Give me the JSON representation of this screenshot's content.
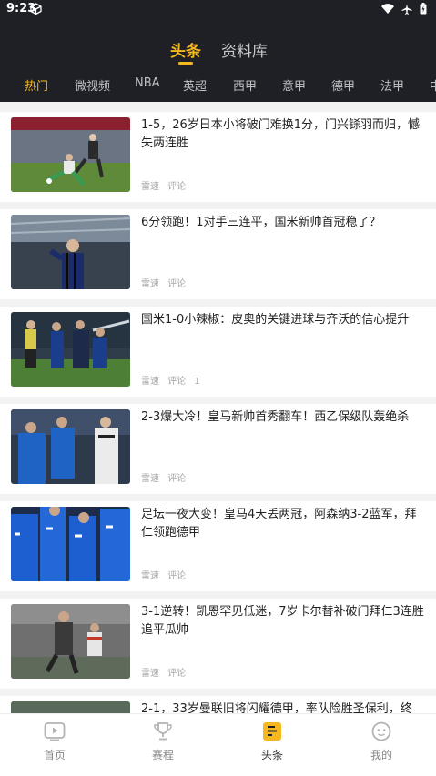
{
  "status": {
    "time": "9:23"
  },
  "top_tabs": [
    {
      "label": "头条",
      "active": true
    },
    {
      "label": "资料库",
      "active": false
    }
  ],
  "categories": [
    "热门",
    "微视频",
    "NBA",
    "英超",
    "西甲",
    "意甲",
    "德甲",
    "法甲",
    "中"
  ],
  "articles": [
    {
      "title": "1-5，26岁日本小将破门难换1分，门兴铩羽而归，憾失两连胜",
      "source": "雷速",
      "comment_label": "评论",
      "comment_count": ""
    },
    {
      "title": "6分领跑！1对手三连平，国米新帅首冠稳了？",
      "source": "雷速",
      "comment_label": "评论",
      "comment_count": ""
    },
    {
      "title": "国米1-0小辣椒：皮奥的关键进球与齐沃的信心提升",
      "source": "雷速",
      "comment_label": "评论",
      "comment_count": "1"
    },
    {
      "title": "2-3爆大冷！皇马新帅首秀翻车！西乙保级队轰绝杀",
      "source": "雷速",
      "comment_label": "评论",
      "comment_count": ""
    },
    {
      "title": "足坛一夜大变！皇马4天丢两冠，阿森纳3-2蓝军，拜仁领跑德甲",
      "source": "雷速",
      "comment_label": "评论",
      "comment_count": ""
    },
    {
      "title": "3-1逆转！凯恩罕见低迷，7岁卡尔替补破门拜仁3连胜追平瓜帅",
      "source": "雷速",
      "comment_label": "评论",
      "comment_count": ""
    },
    {
      "title": "2-1，33岁曼联旧将闪耀德甲，率队险胜圣保利，终",
      "source": "",
      "comment_label": "",
      "comment_count": ""
    }
  ],
  "bottom_nav": [
    {
      "label": "首页",
      "icon": "play-icon",
      "active": false
    },
    {
      "label": "赛程",
      "icon": "trophy-icon",
      "active": false
    },
    {
      "label": "头条",
      "icon": "news-icon",
      "active": true
    },
    {
      "label": "我的",
      "icon": "profile-icon",
      "active": false
    }
  ],
  "colors": {
    "accent": "#f5b820",
    "header_bg": "#1e2026"
  }
}
